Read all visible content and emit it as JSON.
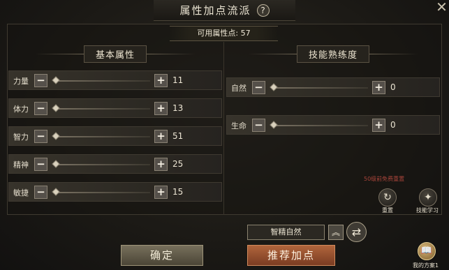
{
  "title": "属性加点流派",
  "help_icon": "?",
  "close_icon": "✕",
  "available_points": "可用属性点: 57",
  "sections": {
    "basic": "基本属性",
    "skill": "技能熟练度"
  },
  "attributes": [
    {
      "label": "力量",
      "value": "11"
    },
    {
      "label": "体力",
      "value": "13"
    },
    {
      "label": "智力",
      "value": "51"
    },
    {
      "label": "精神",
      "value": "25"
    },
    {
      "label": "敏捷",
      "value": "15"
    }
  ],
  "skills": [
    {
      "label": "自然",
      "value": "0"
    },
    {
      "label": "生命",
      "value": "0"
    }
  ],
  "free_reset_note": "50级前免费重置",
  "reset_label": "重置",
  "skill_learn_label": "技能学习",
  "scheme_name": "智精自然",
  "confirm_label": "确定",
  "recommend_label": "推荐加点",
  "my_plans_label": "我的方案1",
  "icons": {
    "minus": "−",
    "plus": "+",
    "reset": "↻",
    "skill_learn": "✦",
    "collapse": "︽",
    "refresh": "⇄",
    "book": "📖"
  }
}
